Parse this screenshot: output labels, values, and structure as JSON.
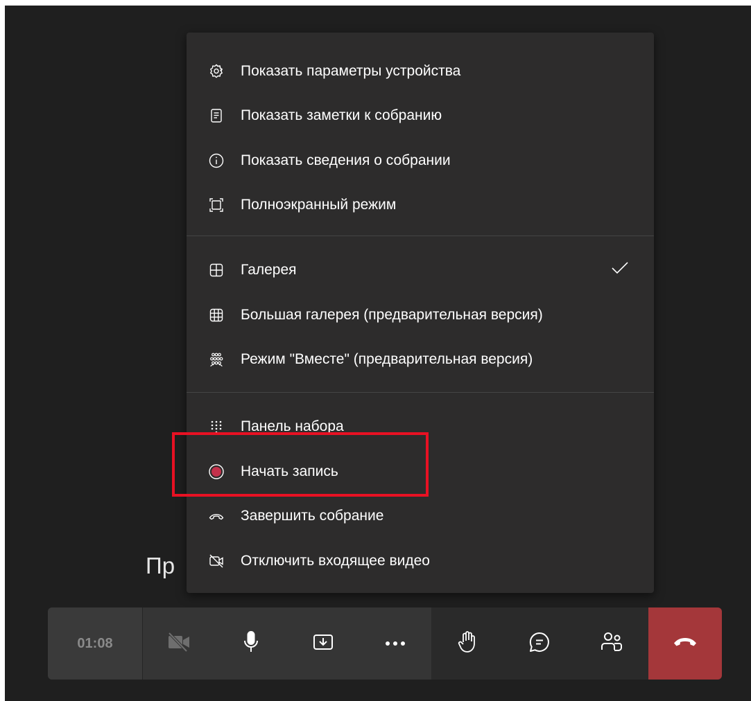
{
  "background": {
    "text": "Пр"
  },
  "menu": {
    "items": [
      {
        "label": "Показать параметры устройства",
        "icon": "gear-icon"
      },
      {
        "label": "Показать заметки к собранию",
        "icon": "notes-icon"
      },
      {
        "label": "Показать сведения о собрании",
        "icon": "info-icon"
      },
      {
        "label": "Полноэкранный режим",
        "icon": "fullscreen-icon"
      },
      {
        "label": "Галерея",
        "icon": "gallery-icon",
        "checked": true
      },
      {
        "label": "Большая галерея (предварительная версия)",
        "icon": "large-gallery-icon"
      },
      {
        "label": "Режим \"Вместе\" (предварительная версия)",
        "icon": "together-mode-icon"
      },
      {
        "label": "Панель набора",
        "icon": "dialpad-icon"
      },
      {
        "label": "Начать запись",
        "icon": "record-icon"
      },
      {
        "label": "Завершить собрание",
        "icon": "end-call-icon"
      },
      {
        "label": "Отключить входящее видео",
        "icon": "video-off-icon"
      }
    ]
  },
  "controls": {
    "timer": "01:08",
    "buttons": [
      {
        "name": "camera-off-button",
        "icon": "camera-off-icon"
      },
      {
        "name": "microphone-button",
        "icon": "microphone-icon"
      },
      {
        "name": "share-button",
        "icon": "share-tray-icon"
      },
      {
        "name": "more-actions-button",
        "icon": "more-icon"
      },
      {
        "name": "raise-hand-button",
        "icon": "hand-icon"
      },
      {
        "name": "chat-button",
        "icon": "chat-icon"
      },
      {
        "name": "participants-button",
        "icon": "people-icon"
      },
      {
        "name": "hang-up-button",
        "icon": "phone-hangup-icon"
      }
    ]
  },
  "colors": {
    "menu_bg": "#2d2c2c",
    "stage_bg": "#1f1f1f",
    "record_dot": "#c4314b",
    "hangup_bg": "#a4373a",
    "highlight": "#e81123"
  }
}
